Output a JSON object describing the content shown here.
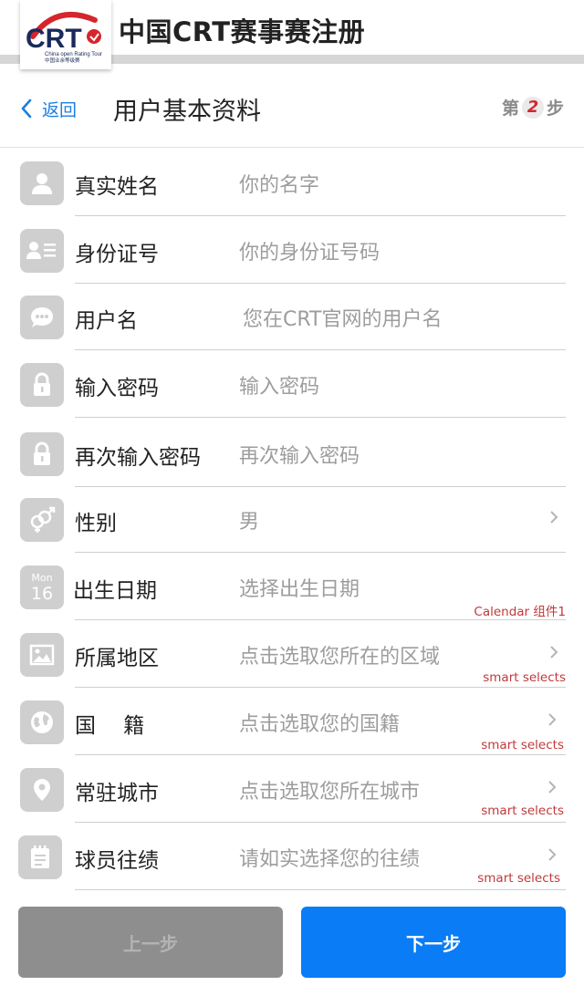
{
  "header": {
    "logo_text": "CRT",
    "logo_subtitle": "China open Rating Tour",
    "logo_subtitle_cn": "中国业余等级赛",
    "title": "中国CRT赛事赛注册",
    "brand_red": "#d4262c"
  },
  "nav": {
    "back_label": "返回",
    "page_title": "用户基本资料",
    "step_prefix": "第",
    "step_number": "2",
    "step_suffix": "步"
  },
  "form": {
    "rows": [
      {
        "icon": "person-icon",
        "label": "真实姓名",
        "placeholder": "你的名字"
      },
      {
        "icon": "id-card-icon",
        "label": "身份证号",
        "placeholder": "你的身份证号码"
      },
      {
        "icon": "chat-bubble-icon",
        "label": "用户名",
        "placeholder": "您在CRT官网的用户名"
      },
      {
        "icon": "lock-icon",
        "label": "输入密码",
        "placeholder": "输入密码"
      },
      {
        "icon": "lock-icon",
        "label": "再次输入密码",
        "placeholder": "再次输入密码"
      },
      {
        "icon": "gender-icon",
        "label": "性别",
        "value": "男"
      },
      {
        "icon": "calendar-icon",
        "calendar_month": "Mon",
        "calendar_day": "16",
        "label": "出生日期",
        "placeholder": "选择出生日期",
        "note": "Calendar 组件1"
      },
      {
        "icon": "image-icon",
        "label": "所属地区",
        "placeholder": "点击选取您所在的区域",
        "note": "smart selects"
      },
      {
        "icon": "globe-icon",
        "label": "国　 籍",
        "placeholder": "点击选取您的国籍",
        "note": "smart selects"
      },
      {
        "icon": "location-pin-icon",
        "label": "常驻城市",
        "placeholder": "点击选取您所在城市",
        "note": "smart selects"
      },
      {
        "icon": "notepad-icon",
        "label": "球员往绩",
        "placeholder": "请如实选择您的往绩",
        "note": "smart selects"
      }
    ]
  },
  "footer": {
    "prev_label": "上一步",
    "next_label": "下一步",
    "accent_blue": "#0a7cf5"
  }
}
